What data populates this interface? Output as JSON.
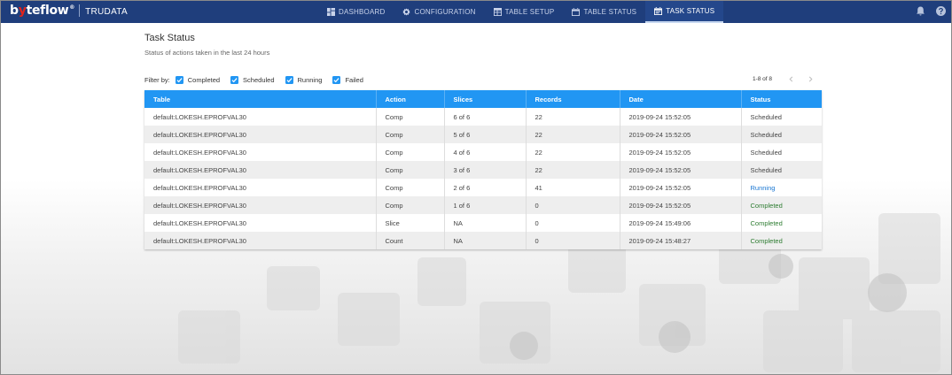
{
  "app": {
    "logo_pre": "b",
    "logo_red": "y",
    "logo_post": "teflow",
    "logo_mark": "®",
    "product": "TRUDATA"
  },
  "nav": {
    "items": [
      {
        "label": "DASHBOARD",
        "icon": "dashboard-icon"
      },
      {
        "label": "CONFIGURATION",
        "icon": "gear-icon"
      },
      {
        "label": "TABLE SETUP",
        "icon": "table-icon"
      },
      {
        "label": "TABLE STATUS",
        "icon": "calendar-icon"
      },
      {
        "label": "TASK STATUS",
        "icon": "calendar-check-icon",
        "active": true
      }
    ]
  },
  "top_icons": [
    "bell-icon",
    "help-icon"
  ],
  "page": {
    "title": "Task Status",
    "subtitle": "Status of actions taken in the last 24 hours"
  },
  "filter": {
    "label": "Filter by:",
    "options": [
      {
        "label": "Completed",
        "checked": true
      },
      {
        "label": "Scheduled",
        "checked": true
      },
      {
        "label": "Running",
        "checked": true
      },
      {
        "label": "Failed",
        "checked": true
      }
    ]
  },
  "pager": {
    "text": "1-8 of 8"
  },
  "table": {
    "headers": [
      "Table",
      "Action",
      "Slices",
      "Records",
      "Date",
      "Status"
    ],
    "rows": [
      [
        "default:LOKESH.EPROFVAL30",
        "Comp",
        "6 of 6",
        "22",
        "2019-09-24 15:52:05",
        "Scheduled"
      ],
      [
        "default:LOKESH.EPROFVAL30",
        "Comp",
        "5 of 6",
        "22",
        "2019-09-24 15:52:05",
        "Scheduled"
      ],
      [
        "default:LOKESH.EPROFVAL30",
        "Comp",
        "4 of 6",
        "22",
        "2019-09-24 15:52:05",
        "Scheduled"
      ],
      [
        "default:LOKESH.EPROFVAL30",
        "Comp",
        "3 of 6",
        "22",
        "2019-09-24 15:52:05",
        "Scheduled"
      ],
      [
        "default:LOKESH.EPROFVAL30",
        "Comp",
        "2 of 6",
        "41",
        "2019-09-24 15:52:05",
        "Running"
      ],
      [
        "default:LOKESH.EPROFVAL30",
        "Comp",
        "1 of 6",
        "0",
        "2019-09-24 15:52:05",
        "Completed"
      ],
      [
        "default:LOKESH.EPROFVAL30",
        "Slice",
        "NA",
        "0",
        "2019-09-24 15:49:06",
        "Completed"
      ],
      [
        "default:LOKESH.EPROFVAL30",
        "Count",
        "NA",
        "0",
        "2019-09-24 15:48:27",
        "Completed"
      ]
    ]
  },
  "colors": {
    "topbar": "#1f3e7c",
    "header": "#2196f3",
    "status_scheduled": "#444444",
    "status_running": "#1976d2",
    "status_completed": "#2e7d32"
  }
}
